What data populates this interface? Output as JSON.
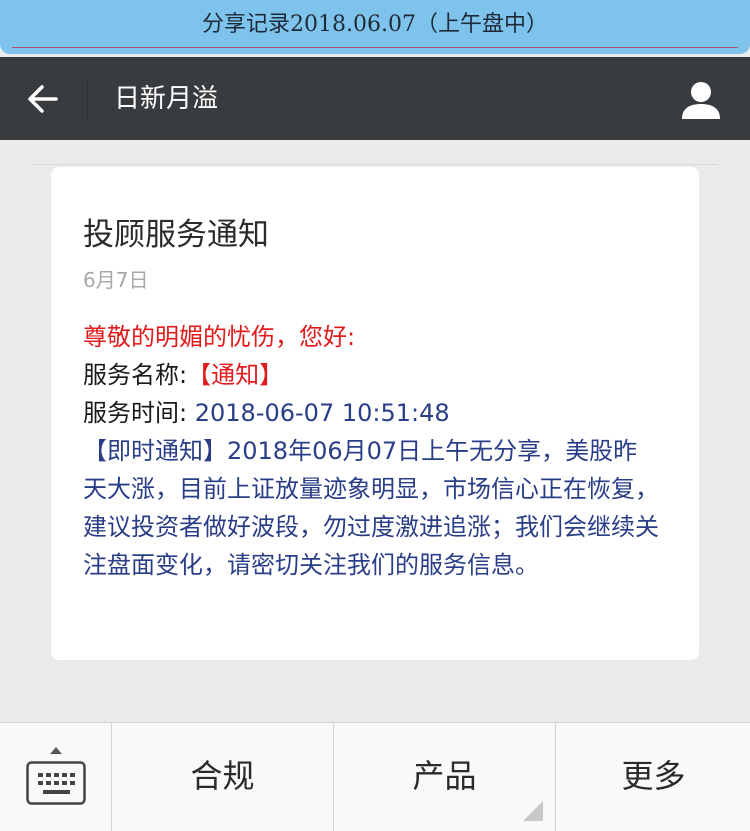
{
  "banner": {
    "title": "分享记录2018.06.07（上午盘中）"
  },
  "navbar": {
    "back_icon": "arrow-left-icon",
    "title": "日新月溢",
    "profile_icon": "person-icon"
  },
  "message": {
    "title": "投顾服务通知",
    "date": "6月7日",
    "greeting": "尊敬的明媚的忧伤，您好:",
    "service_name_label": "服务名称:",
    "service_name_value": "【通知】",
    "service_time_label": "服务时间:",
    "service_time_value": "2018-06-07 10:51:48",
    "notice": "【即时通知】2018年06月07日上午无分享，美股昨天大涨，目前上证放量迹象明显，市场信心正在恢复，建议投资者做好波段，勿过度激进追涨；我们会继续关注盘面变化，请密切关注我们的服务信息。"
  },
  "bottom_menu": {
    "keyboard_icon": "keyboard-icon",
    "items": [
      {
        "label": "合规"
      },
      {
        "label": "产品"
      },
      {
        "label": "更多"
      }
    ]
  },
  "colors": {
    "navbar_bg": "#383c3f",
    "banner_bg": "#7ec3ec",
    "highlight_red": "#e21b1b",
    "text_blue": "#2a3e88",
    "page_bg": "#ebebeb"
  }
}
